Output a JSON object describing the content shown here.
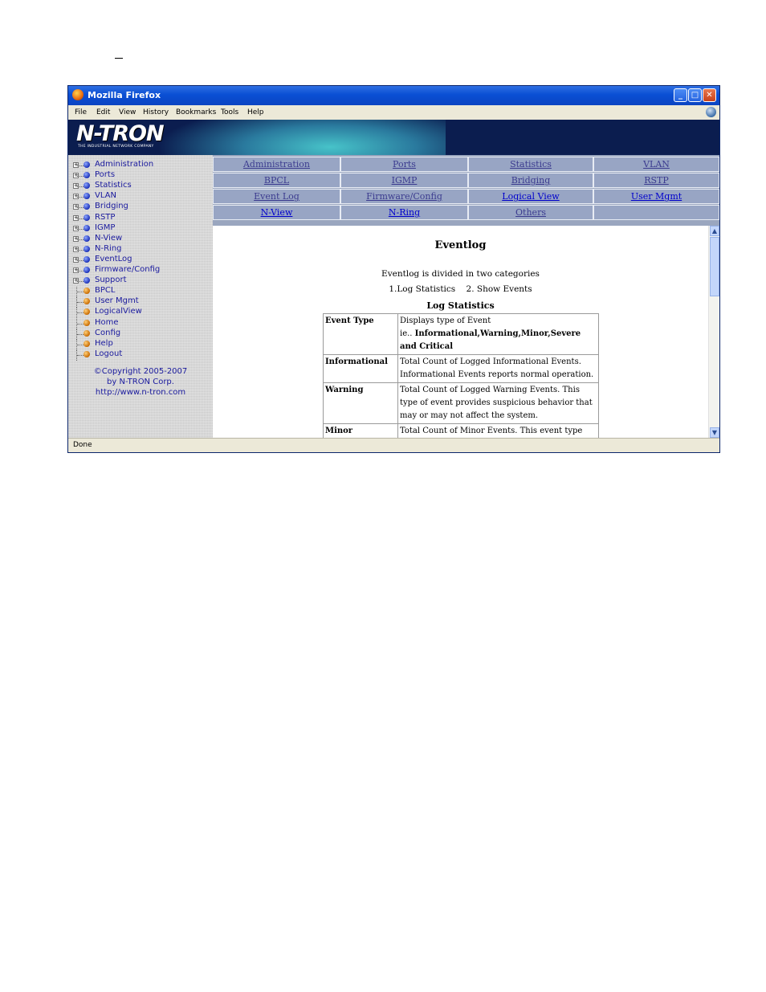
{
  "window": {
    "title": "Mozilla Firefox"
  },
  "menubar": [
    "File",
    "Edit",
    "View",
    "History",
    "Bookmarks",
    "Tools",
    "Help"
  ],
  "banner": {
    "logo": "N-TRON",
    "tagline": "THE INDUSTRIAL NETWORK COMPANY"
  },
  "sidebar": {
    "items": [
      {
        "label": "Administration",
        "type": "folder"
      },
      {
        "label": "Ports",
        "type": "folder"
      },
      {
        "label": "Statistics",
        "type": "folder"
      },
      {
        "label": "VLAN",
        "type": "folder"
      },
      {
        "label": "Bridging",
        "type": "folder"
      },
      {
        "label": "RSTP",
        "type": "folder"
      },
      {
        "label": "IGMP",
        "type": "folder"
      },
      {
        "label": "N-View",
        "type": "folder"
      },
      {
        "label": "N-Ring",
        "type": "folder"
      },
      {
        "label": "EventLog",
        "type": "folder"
      },
      {
        "label": "Firmware/Config",
        "type": "folder"
      },
      {
        "label": "Support",
        "type": "folder"
      },
      {
        "label": "BPCL",
        "type": "leaf"
      },
      {
        "label": "User Mgmt",
        "type": "leaf"
      },
      {
        "label": "LogicalView",
        "type": "leaf"
      },
      {
        "label": "Home",
        "type": "leaf"
      },
      {
        "label": "Config",
        "type": "leaf"
      },
      {
        "label": "Help",
        "type": "leaf"
      },
      {
        "label": "Logout",
        "type": "leaf"
      }
    ],
    "copyright": [
      "©Copyright 2005-2007",
      "by N-TRON Corp.",
      "http://www.n-tron.com"
    ]
  },
  "nav": {
    "rows": [
      [
        "Administration",
        "Ports",
        "Statistics",
        "VLAN"
      ],
      [
        "BPCL",
        "IGMP",
        "Bridging",
        "RSTP"
      ],
      [
        "Event Log",
        "Firmware/Config",
        "Logical View",
        "User Mgmt"
      ],
      [
        "N-View",
        "N-Ring",
        "Others",
        ""
      ]
    ]
  },
  "content": {
    "heading": "Eventlog",
    "intro": "Eventlog is divided in two categories",
    "categories": "1.Log Statistics    2. Show Events",
    "section": "Log Statistics",
    "table": [
      {
        "key": "Event Type",
        "desc": "Displays type of Event",
        "desc2": "ie.. ",
        "desc_bold": "Informational,Warning,Minor,Severe and Critical"
      },
      {
        "key": "Informational",
        "desc": "Total Count of Logged Informational Events. Informational Events reports normal operation."
      },
      {
        "key": "Warning",
        "desc": "Total Count of Logged Warning Events. This type of event provides suspicious behavior that may or may not affect the system."
      },
      {
        "key": "Minor",
        "desc": "Total Count of Minor Events. This event type"
      }
    ]
  },
  "status": {
    "text": "Done"
  }
}
